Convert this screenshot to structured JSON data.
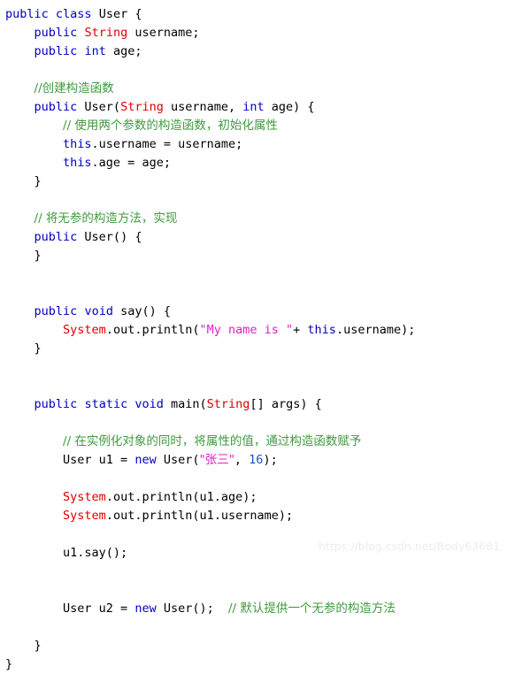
{
  "editor": {
    "language": "java",
    "background_color": "#ffffff",
    "colors": {
      "keyword": "#0000c0",
      "type": "#dd0000",
      "string": "#e020c0",
      "comment": "#3f9a3f",
      "number": "#1a4fd0",
      "plain": "#000000",
      "watermark": "#ededed"
    },
    "watermark": "https://blog.csdn.net/Body63681",
    "lines": [
      {
        "n": 1,
        "tokens": [
          {
            "t": "public",
            "c": "keyword"
          },
          {
            "t": " ",
            "c": "plain"
          },
          {
            "t": "class",
            "c": "keyword"
          },
          {
            "t": " User {",
            "c": "plain"
          }
        ]
      },
      {
        "n": 2,
        "tokens": [
          {
            "t": "    ",
            "c": "plain"
          },
          {
            "t": "public",
            "c": "keyword"
          },
          {
            "t": " ",
            "c": "plain"
          },
          {
            "t": "String",
            "c": "type"
          },
          {
            "t": " username;",
            "c": "plain"
          }
        ]
      },
      {
        "n": 3,
        "tokens": [
          {
            "t": "    ",
            "c": "plain"
          },
          {
            "t": "public",
            "c": "keyword"
          },
          {
            "t": " ",
            "c": "plain"
          },
          {
            "t": "int",
            "c": "keyword"
          },
          {
            "t": " age;",
            "c": "plain"
          }
        ]
      },
      {
        "n": 4,
        "tokens": []
      },
      {
        "n": 5,
        "tokens": [
          {
            "t": "    ",
            "c": "plain"
          },
          {
            "t": "//创建构造函数",
            "c": "comment",
            "cjk": true
          }
        ]
      },
      {
        "n": 6,
        "tokens": [
          {
            "t": "    ",
            "c": "plain"
          },
          {
            "t": "public",
            "c": "keyword"
          },
          {
            "t": " User(",
            "c": "plain"
          },
          {
            "t": "String",
            "c": "type"
          },
          {
            "t": " username, ",
            "c": "plain"
          },
          {
            "t": "int",
            "c": "keyword"
          },
          {
            "t": " age) {",
            "c": "plain"
          }
        ]
      },
      {
        "n": 7,
        "tokens": [
          {
            "t": "        ",
            "c": "plain"
          },
          {
            "t": "// 使用两个参数的构造函数，初始化属性",
            "c": "comment",
            "cjk": true
          }
        ]
      },
      {
        "n": 8,
        "tokens": [
          {
            "t": "        ",
            "c": "plain"
          },
          {
            "t": "this",
            "c": "keyword"
          },
          {
            "t": ".username = username;",
            "c": "plain"
          }
        ]
      },
      {
        "n": 9,
        "tokens": [
          {
            "t": "        ",
            "c": "plain"
          },
          {
            "t": "this",
            "c": "keyword"
          },
          {
            "t": ".age = age;",
            "c": "plain"
          }
        ]
      },
      {
        "n": 10,
        "tokens": [
          {
            "t": "    }",
            "c": "plain"
          }
        ]
      },
      {
        "n": 11,
        "tokens": []
      },
      {
        "n": 12,
        "tokens": [
          {
            "t": "    ",
            "c": "plain"
          },
          {
            "t": "// 将无参的构造方法，实现",
            "c": "comment",
            "cjk": true
          }
        ]
      },
      {
        "n": 13,
        "tokens": [
          {
            "t": "    ",
            "c": "plain"
          },
          {
            "t": "public",
            "c": "keyword"
          },
          {
            "t": " User() {",
            "c": "plain"
          }
        ]
      },
      {
        "n": 14,
        "tokens": [
          {
            "t": "    }",
            "c": "plain"
          }
        ]
      },
      {
        "n": 15,
        "tokens": []
      },
      {
        "n": 16,
        "tokens": []
      },
      {
        "n": 17,
        "tokens": [
          {
            "t": "    ",
            "c": "plain"
          },
          {
            "t": "public",
            "c": "keyword"
          },
          {
            "t": " ",
            "c": "plain"
          },
          {
            "t": "void",
            "c": "keyword"
          },
          {
            "t": " say() {",
            "c": "plain"
          }
        ]
      },
      {
        "n": 18,
        "tokens": [
          {
            "t": "        ",
            "c": "plain"
          },
          {
            "t": "System",
            "c": "type"
          },
          {
            "t": ".out.println(",
            "c": "plain"
          },
          {
            "t": "\"My name is \"",
            "c": "string"
          },
          {
            "t": "+ ",
            "c": "plain"
          },
          {
            "t": "this",
            "c": "keyword"
          },
          {
            "t": ".username);",
            "c": "plain"
          }
        ]
      },
      {
        "n": 19,
        "tokens": [
          {
            "t": "    }",
            "c": "plain"
          }
        ]
      },
      {
        "n": 20,
        "tokens": []
      },
      {
        "n": 21,
        "tokens": []
      },
      {
        "n": 22,
        "tokens": [
          {
            "t": "    ",
            "c": "plain"
          },
          {
            "t": "public",
            "c": "keyword"
          },
          {
            "t": " ",
            "c": "plain"
          },
          {
            "t": "static",
            "c": "keyword"
          },
          {
            "t": " ",
            "c": "plain"
          },
          {
            "t": "void",
            "c": "keyword"
          },
          {
            "t": " main(",
            "c": "plain"
          },
          {
            "t": "String",
            "c": "type"
          },
          {
            "t": "[] args) {",
            "c": "plain"
          }
        ]
      },
      {
        "n": 23,
        "tokens": []
      },
      {
        "n": 24,
        "tokens": [
          {
            "t": "        ",
            "c": "plain"
          },
          {
            "t": "// 在实例化对象的同时，将属性的值，通过构造函数赋予",
            "c": "comment",
            "cjk": true
          }
        ]
      },
      {
        "n": 25,
        "tokens": [
          {
            "t": "        User u1 = ",
            "c": "plain"
          },
          {
            "t": "new",
            "c": "keyword"
          },
          {
            "t": " User(",
            "c": "plain"
          },
          {
            "t": "\"张三\"",
            "c": "string",
            "cjk": true
          },
          {
            "t": ", ",
            "c": "plain"
          },
          {
            "t": "16",
            "c": "number"
          },
          {
            "t": ");",
            "c": "plain"
          }
        ]
      },
      {
        "n": 26,
        "tokens": []
      },
      {
        "n": 27,
        "tokens": [
          {
            "t": "        ",
            "c": "plain"
          },
          {
            "t": "System",
            "c": "type"
          },
          {
            "t": ".out.println(u1.age);",
            "c": "plain"
          }
        ]
      },
      {
        "n": 28,
        "tokens": [
          {
            "t": "        ",
            "c": "plain"
          },
          {
            "t": "System",
            "c": "type"
          },
          {
            "t": ".out.println(u1.username);",
            "c": "plain"
          }
        ]
      },
      {
        "n": 29,
        "tokens": []
      },
      {
        "n": 30,
        "tokens": [
          {
            "t": "        u1.say();",
            "c": "plain"
          }
        ]
      },
      {
        "n": 31,
        "tokens": []
      },
      {
        "n": 32,
        "tokens": []
      },
      {
        "n": 33,
        "tokens": [
          {
            "t": "        User u2 = ",
            "c": "plain"
          },
          {
            "t": "new",
            "c": "keyword"
          },
          {
            "t": " User();  ",
            "c": "plain"
          },
          {
            "t": "// 默认提供一个无参的构造方法",
            "c": "comment",
            "cjk": true
          }
        ]
      },
      {
        "n": 34,
        "tokens": []
      },
      {
        "n": 35,
        "tokens": [
          {
            "t": "    }",
            "c": "plain"
          }
        ]
      },
      {
        "n": 36,
        "tokens": [
          {
            "t": "}",
            "c": "plain"
          }
        ]
      }
    ]
  }
}
